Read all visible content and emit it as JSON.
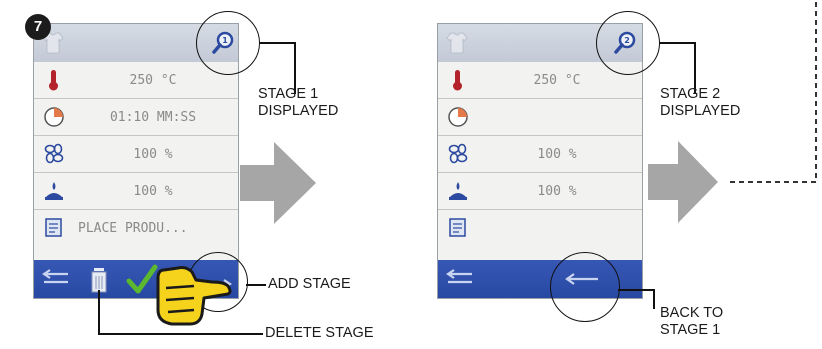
{
  "step": {
    "number": "7"
  },
  "screen1": {
    "rows": [
      {
        "icon": "thermometer-icon",
        "value": "250 °C"
      },
      {
        "icon": "clock-icon",
        "value": "01:10 MM:SS"
      },
      {
        "icon": "fan-icon",
        "value": "100 %"
      },
      {
        "icon": "steam-icon",
        "value": "100 %"
      },
      {
        "icon": "message-icon",
        "value": "PLACE PRODU..."
      }
    ],
    "bottom_icons": [
      "back-arrow-icon",
      "trash-icon",
      "checkmark-icon",
      "forward-arrow-icon"
    ]
  },
  "screen2": {
    "rows": [
      {
        "icon": "thermometer-icon",
        "value": "250 °C"
      },
      {
        "icon": "clock-icon",
        "value": ""
      },
      {
        "icon": "fan-icon",
        "value": "100 %"
      },
      {
        "icon": "steam-icon",
        "value": "100 %"
      },
      {
        "icon": "message-icon",
        "value": ""
      }
    ],
    "bottom_icons": [
      "back-arrow-icon",
      "back-arrow-icon"
    ]
  },
  "callouts": {
    "stage1": {
      "line1": "STAGE 1",
      "line2": "DISPLAYED"
    },
    "stage2": {
      "line1": "STAGE 2",
      "line2": "DISPLAYED"
    },
    "add_stage": "ADD STAGE",
    "delete_stage": "DELETE STAGE",
    "back_to_stage1": {
      "line1": "BACK TO",
      "line2": "STAGE 1"
    }
  },
  "colors": {
    "bottom_bar": "#2b4ca6",
    "arrow": "#a6a6a6",
    "hand": "#f5d21c",
    "check": "#5cb82e",
    "thermometer": "#b4232c",
    "clock": "#e47a4a",
    "dashed_line": "#333333"
  }
}
